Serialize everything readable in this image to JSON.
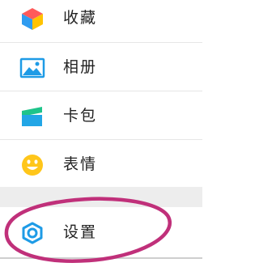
{
  "menu": {
    "items": [
      {
        "label": "收藏",
        "icon": "cube-icon"
      },
      {
        "label": "相册",
        "icon": "image-icon"
      },
      {
        "label": "卡包",
        "icon": "wallet-card-icon"
      },
      {
        "label": "表情",
        "icon": "smiley-icon"
      },
      {
        "label": "设置",
        "icon": "gear-icon"
      }
    ]
  },
  "colors": {
    "cube_top": "#ff5a5a",
    "cube_left": "#2f9cf0",
    "cube_right": "#ffc300",
    "image_blue": "#1e9be6",
    "card_green": "#1ec48a",
    "card_blue": "#22a6e6",
    "smiley_yellow": "#ffc61a",
    "gear_blue": "#1e9be6",
    "highlight": "#c0307a"
  }
}
